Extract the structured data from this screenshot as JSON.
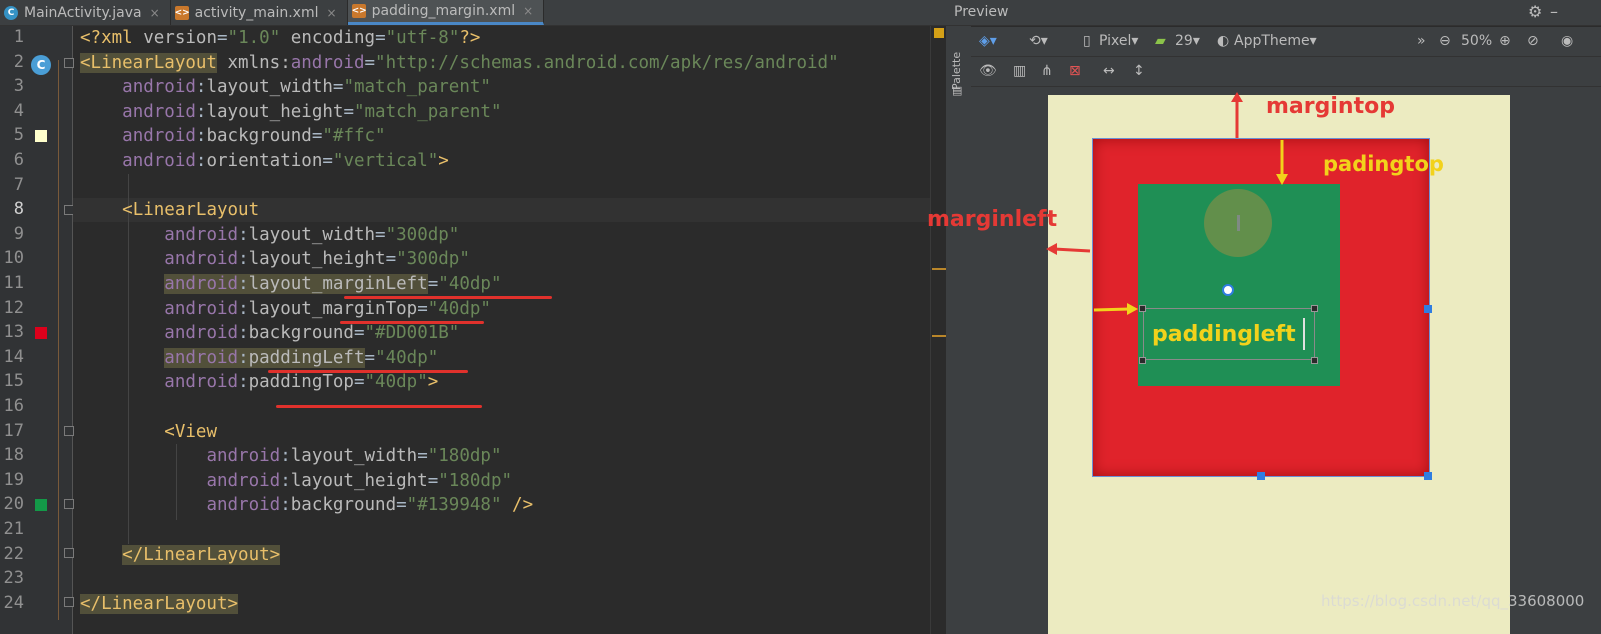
{
  "tabs": [
    {
      "label": "MainActivity.java",
      "icon": "java-class-icon",
      "close": "×"
    },
    {
      "label": "activity_main.xml",
      "icon": "xml-file-icon",
      "close": "×"
    },
    {
      "label": "padding_margin.xml",
      "icon": "xml-file-icon",
      "close": "×",
      "active": true
    }
  ],
  "editor": {
    "line_numbers": [
      "1",
      "2",
      "3",
      "4",
      "5",
      "6",
      "7",
      "8",
      "9",
      "10",
      "11",
      "12",
      "13",
      "14",
      "15",
      "16",
      "17",
      "18",
      "19",
      "20",
      "21",
      "22",
      "23",
      "24"
    ],
    "current_line": "8"
  },
  "preview": {
    "title": "Preview",
    "palette_label": "Palette",
    "device": "Pixel",
    "api_level": "29",
    "theme": "AppTheme",
    "zoom": "50%",
    "more": "»"
  },
  "annotations": {
    "margin_top": "margintop",
    "padding_top": "padingtop",
    "margin_left": "marginleft",
    "padding_left": "paddingleft"
  },
  "colors": {
    "outer_background": "#DD001B",
    "inner_background": "#139948",
    "root_background": "#ffc",
    "annotation_red": "#e53935",
    "annotation_yellow": "#f2d21b"
  },
  "watermark": "https://blog.csdn.net/qq_33608000"
}
